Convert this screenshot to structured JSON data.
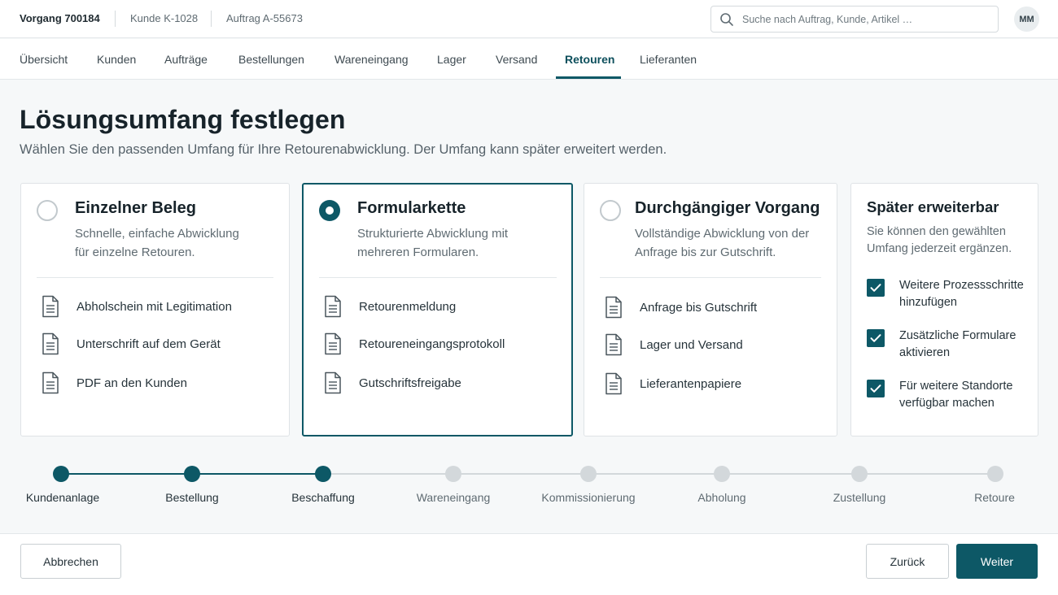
{
  "header": {
    "breadcrumbs": [
      "Vorgang 700184",
      "Kunde K-1028",
      "Auftrag A-55673"
    ],
    "search_placeholder": "Suche nach Auftrag, Kunde, Artikel …",
    "avatar_initials": "MM"
  },
  "nav": {
    "tabs": [
      "Übersicht",
      "Kunden",
      "Aufträge",
      "Bestellungen",
      "Wareneingang",
      "Lager",
      "Versand",
      "Retouren",
      "Lieferanten"
    ],
    "active": "Retouren"
  },
  "page": {
    "title": "Lösungsumfang festlegen",
    "subtitle": "Wählen Sie den passenden Umfang für Ihre Retourenabwicklung. Der Umfang kann später erweitert werden."
  },
  "options": [
    {
      "title": "Einzelner Beleg",
      "desc_line1": "Schnelle, einfache Abwicklung",
      "desc_line2": "für einzelne Retouren.",
      "selected": false,
      "items": [
        "Abholschein mit Legitimation",
        "Unterschrift auf dem Gerät",
        "PDF an den Kunden"
      ]
    },
    {
      "title": "Formularkette",
      "desc_line1": "Strukturierte Abwicklung mit",
      "desc_line2": "mehreren Formularen.",
      "selected": true,
      "items": [
        "Retourenmeldung",
        "Retoureneingangsprotokoll",
        "Gutschriftsfreigabe"
      ]
    },
    {
      "title": "Durchgängiger Vorgang",
      "desc_line1": "Vollständige Abwicklung von der",
      "desc_line2": "Anfrage bis zur Gutschrift.",
      "selected": false,
      "items": [
        "Anfrage bis Gutschrift",
        "Lager und Versand",
        "Lieferantenpapiere"
      ]
    }
  ],
  "extension": {
    "title": "Später erweiterbar",
    "desc_line1": "Sie können den gewählten",
    "desc_line2": "Umfang jederzeit ergänzen.",
    "items": [
      {
        "line1": "Weitere Prozessschritte",
        "line2": "hinzufügen",
        "checked": true
      },
      {
        "line1": "Zusätzliche Formulare",
        "line2": "aktivieren",
        "checked": true
      },
      {
        "line1": "Für weitere Standorte",
        "line2": "verfügbar machen",
        "checked": true
      }
    ]
  },
  "stepper": {
    "steps": [
      "Kundenanlage",
      "Bestellung",
      "Beschaffung",
      "Wareneingang",
      "Kommissionierung",
      "Abholung",
      "Zustellung",
      "Retoure"
    ],
    "completed_count": 3
  },
  "footer": {
    "cancel_label": "Abbrechen",
    "back_label": "Zurück",
    "next_label": "Weiter"
  },
  "colors": {
    "accent": "#0d5866",
    "inactive": "#d3d8db"
  }
}
